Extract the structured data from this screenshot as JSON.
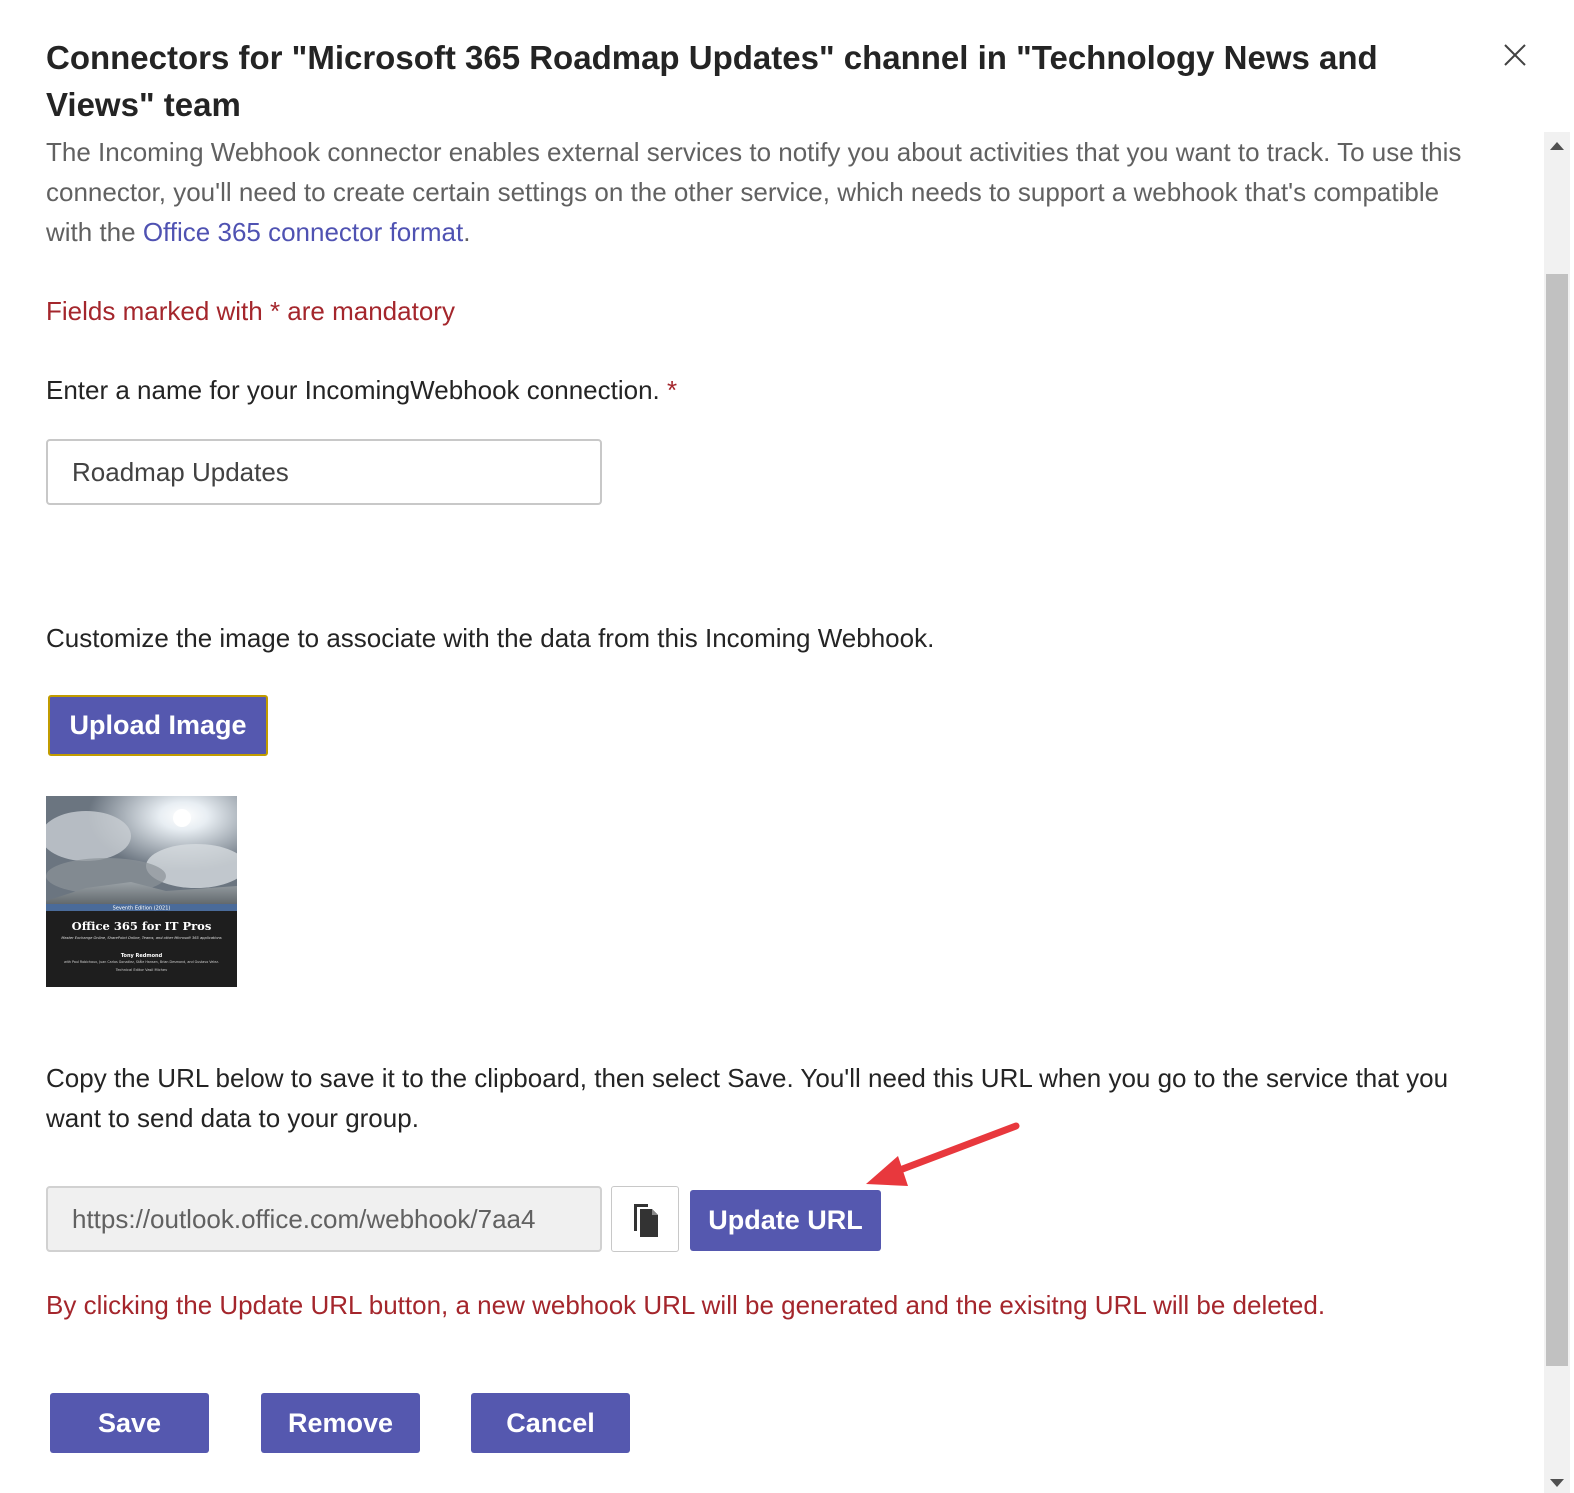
{
  "dialog": {
    "title": "Connectors for \"Microsoft 365 Roadmap Updates\" channel in \"Technology News and Views\" team",
    "close_icon": "close-icon"
  },
  "intro": {
    "text_before_link": "The Incoming Webhook connector enables external services to notify you about activities that you want to track. To use this connector, you'll need to create certain settings on the other service, which needs to support a webhook that's compatible with the ",
    "link_text": "Office 365 connector format",
    "text_after_link": "."
  },
  "mandatory_note": "Fields marked with * are mandatory",
  "name_field": {
    "label": "Enter a name for your IncomingWebhook connection.",
    "required_marker": "*",
    "value": "Roadmap Updates"
  },
  "image_section": {
    "label": "Customize the image to associate with the data from this Incoming Webhook.",
    "upload_button": "Upload Image",
    "thumbnail": {
      "edition": "Seventh Edition (2021)",
      "book_title": "Office 365 for IT Pros",
      "subtitle": "Master Exchange Online, SharePoint Online, Teams, and other Microsoft 365 applications",
      "author": "Tony Redmond",
      "contributors": "with Paul Robichaux, Juan Carlos González, Ståle Hansen, Brian Desmond, and Gustavo Velez.",
      "tech_editor": "Technical Editor Vasil Michev"
    }
  },
  "url_section": {
    "label": "Copy the URL below to save it to the clipboard, then select Save. You'll need this URL when you go to the service that you want to send data to your group.",
    "url_value": "https://outlook.office.com/webhook/7aa4",
    "copy_icon": "copy-icon",
    "update_button": "Update URL",
    "warning": "By clicking the Update URL button, a new webhook URL will be generated and the exisitng URL will be deleted."
  },
  "footer": {
    "save": "Save",
    "remove": "Remove",
    "cancel": "Cancel"
  },
  "colors": {
    "accent": "#5558af",
    "link": "#4f52b2",
    "error_text": "#a4262c",
    "annotation_arrow": "#e8383d"
  }
}
